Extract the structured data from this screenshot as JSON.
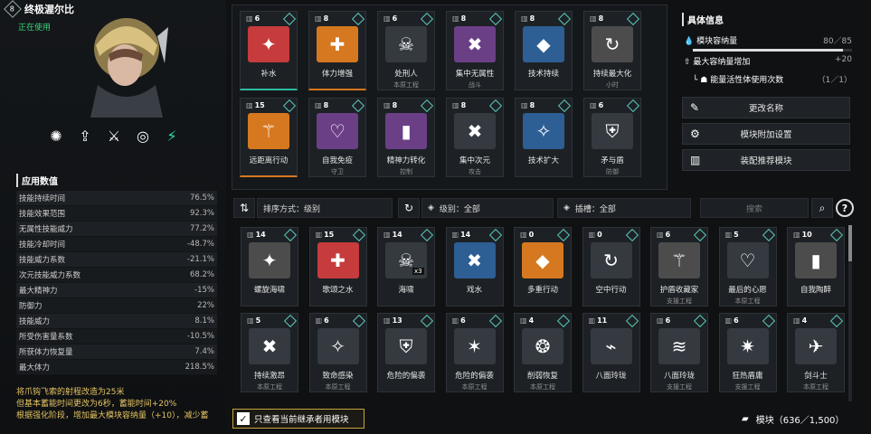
{
  "character": {
    "level": "8",
    "name": "终极渥尔比",
    "status": "正在使用"
  },
  "skills": [
    {
      "icon": "pinwheel-icon",
      "active": false
    },
    {
      "icon": "burst-up-icon",
      "active": false
    },
    {
      "icon": "grapple-icon",
      "active": false
    },
    {
      "icon": "vortex-icon",
      "active": false
    },
    {
      "icon": "energy-swirl-icon",
      "active": true
    }
  ],
  "stats": {
    "title": "应用数值",
    "rows": [
      {
        "label": "技能持续时间",
        "value": "76.5%"
      },
      {
        "label": "技能效果范围",
        "value": "92.3%"
      },
      {
        "label": "无属性技能威力",
        "value": "77.2%"
      },
      {
        "label": "技能冷却时间",
        "value": "-48.7%"
      },
      {
        "label": "技能威力系数",
        "value": "-21.1%"
      },
      {
        "label": "次元技能威力系数",
        "value": "68.2%"
      },
      {
        "label": "最大精神力",
        "value": "-15%"
      },
      {
        "label": "防御力",
        "value": "22%"
      },
      {
        "label": "技能威力",
        "value": "8.1%"
      },
      {
        "label": "所受伤害量系数",
        "value": "-10.5%"
      },
      {
        "label": "所获体力恢复量",
        "value": "7.4%"
      },
      {
        "label": "最大体力",
        "value": "218.5%"
      }
    ]
  },
  "description": {
    "line1": "将爪钩飞索的射程改造为25米",
    "line2": "但基本蓄能时间更改为6秒，蓄能时间+20%",
    "line3": "根据强化阶段，增加最大模块容纳量（+10），减少蓄"
  },
  "equipped": [
    {
      "cost": "6",
      "name": "补水",
      "sub": "",
      "color": "teal",
      "art": "#c63b3b",
      "icon": "water-icon"
    },
    {
      "cost": "8",
      "name": "体力增强",
      "sub": "",
      "color": "orange",
      "art": "#d6781f",
      "icon": "shield-heart-icon"
    },
    {
      "cost": "6",
      "name": "处刑人",
      "sub": "本原工程",
      "color": "none",
      "art": "#343a40",
      "icon": "skull-icon"
    },
    {
      "cost": "8",
      "name": "集中无属性",
      "sub": "战斗",
      "color": "none",
      "art": "#6b3f86",
      "icon": "cross-target-icon"
    },
    {
      "cost": "8",
      "name": "技术持续",
      "sub": "",
      "color": "none",
      "art": "#2d5e94",
      "icon": "diamond-icon"
    },
    {
      "cost": "8",
      "name": "持续最大化",
      "sub": "小时",
      "color": "none",
      "art": "#4c4c4c",
      "icon": "cycle-icon"
    },
    {
      "cost": "15",
      "name": "远距离行动",
      "sub": "",
      "color": "orange",
      "art": "#d6781f",
      "icon": "trident-icon"
    },
    {
      "cost": "8",
      "name": "自我免疫",
      "sub": "守卫",
      "color": "none",
      "art": "#6b3f86",
      "icon": "immunity-icon"
    },
    {
      "cost": "8",
      "name": "精神力转化",
      "sub": "控制",
      "color": "none",
      "art": "#6b3f86",
      "icon": "battery-icon"
    },
    {
      "cost": "8",
      "name": "集中次元",
      "sub": "攻击",
      "color": "none",
      "art": "#343a40",
      "icon": "cross-target-icon"
    },
    {
      "cost": "8",
      "name": "技术扩大",
      "sub": "",
      "color": "none",
      "art": "#2d5e94",
      "icon": "star-icon"
    },
    {
      "cost": "6",
      "name": "矛与盾",
      "sub": "防御",
      "color": "none",
      "art": "#343a40",
      "icon": "spear-shield-icon"
    }
  ],
  "info": {
    "title": "具体信息",
    "capacity_label": "模块容纳量",
    "capacity_value": "80／85",
    "capacity_ratio": 0.941,
    "max_increase_label": "最大容纳量增加",
    "max_increase_value": "+20",
    "energy_label": "能量活性体使用次数",
    "energy_value": "（1／1）"
  },
  "actions": [
    {
      "label": "更改名称",
      "icon": "pencil-icon"
    },
    {
      "label": "模块附加设置",
      "icon": "gear-modules-icon"
    },
    {
      "label": "装配推荐模块",
      "icon": "recommend-icon"
    }
  ],
  "filters": {
    "sort_label": "排序方式：级别",
    "grade_label": "级别：全部",
    "slot_label": "插槽：全部",
    "search_placeholder": "搜索"
  },
  "inventory": [
    {
      "cost": "14",
      "name": "螺旋海啸",
      "sub": "",
      "color": "teal",
      "art": "#4c4c4c"
    },
    {
      "cost": "15",
      "name": "歌颂之水",
      "sub": "",
      "color": "teal",
      "art": "#c63b3b"
    },
    {
      "cost": "14",
      "name": "海啸",
      "sub": "",
      "color": "teal",
      "art": "#343a40",
      "badge": "x3"
    },
    {
      "cost": "14",
      "name": "戏水",
      "sub": "",
      "color": "teal",
      "art": "#2d5e94"
    },
    {
      "cost": "0",
      "name": "多重行动",
      "sub": "",
      "color": "orange",
      "art": "#d6781f"
    },
    {
      "cost": "0",
      "name": "空中行动",
      "sub": "",
      "color": "none",
      "art": "#343a40"
    },
    {
      "cost": "6",
      "name": "护盾收藏家",
      "sub": "支援工程",
      "color": "none",
      "art": "#4c4c4c"
    },
    {
      "cost": "5",
      "name": "最后的心愿",
      "sub": "本原工程",
      "color": "none",
      "art": "#343a40"
    },
    {
      "cost": "10",
      "name": "自我陶醉",
      "sub": "",
      "color": "none",
      "art": "#4c4c4c"
    },
    {
      "cost": "5",
      "name": "持续激昂",
      "sub": "本原工程",
      "color": "none",
      "art": "#343a40"
    },
    {
      "cost": "6",
      "name": "致命感染",
      "sub": "本原工程",
      "color": "none",
      "art": "#343a40"
    },
    {
      "cost": "13",
      "name": "危险的偏袭",
      "sub": "",
      "color": "none",
      "art": "#343a40"
    },
    {
      "cost": "6",
      "name": "危险的偏袭",
      "sub": "本原工程",
      "color": "none",
      "art": "#343a40"
    },
    {
      "cost": "4",
      "name": "削弱恢复",
      "sub": "本原工程",
      "color": "none",
      "art": "#343a40"
    },
    {
      "cost": "11",
      "name": "八面玲珑",
      "sub": "",
      "color": "none",
      "art": "#343a40"
    },
    {
      "cost": "6",
      "name": "八面玲珑",
      "sub": "支援工程",
      "color": "none",
      "art": "#343a40"
    },
    {
      "cost": "6",
      "name": "狂热盾庸",
      "sub": "支援工程",
      "color": "none",
      "art": "#343a40"
    },
    {
      "cost": "4",
      "name": "剑斗士",
      "sub": "本原工程",
      "color": "none",
      "art": "#343a40"
    }
  ],
  "bottom": {
    "checkbox_label": "只查看当前继承者用模块",
    "capacity_label": "模块（636／1,500）"
  }
}
